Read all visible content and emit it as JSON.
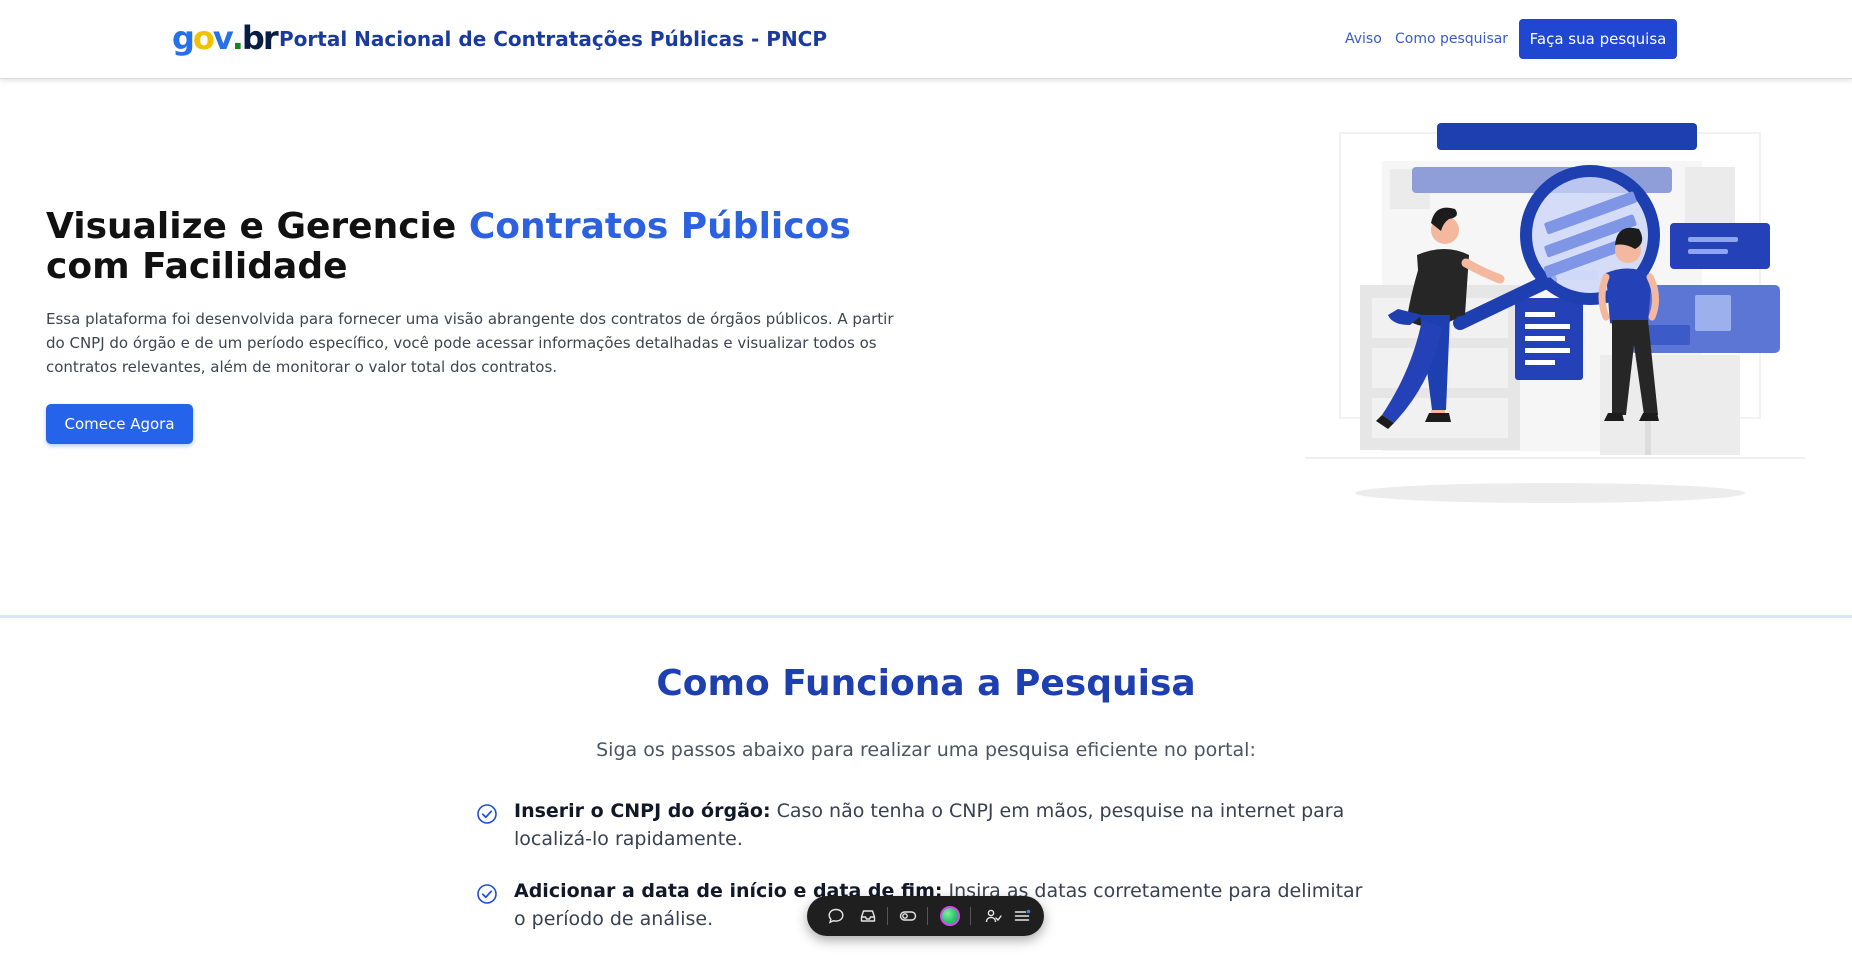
{
  "header": {
    "logo_parts": [
      "g",
      "o",
      "v",
      ".",
      "b",
      "r"
    ],
    "title": "Portal Nacional de Contratações Públicas - PNCP",
    "nav": {
      "aviso": "Aviso",
      "como_pesquisar": "Como pesquisar"
    },
    "cta": "Faça sua pesquisa"
  },
  "hero": {
    "title_part1": "Visualize e Gerencie ",
    "title_accent": "Contratos Públicos",
    "title_part2": " com Facilidade",
    "description": "Essa plataforma foi desenvolvida para fornecer uma visão abrangente dos contratos de órgãos públicos. A partir do CNPJ do órgão e de um período específico, você pode acessar informações detalhadas e visualizar todos os contratos relevantes, além de monitorar o valor total dos contratos.",
    "cta": "Comece Agora"
  },
  "how_it_works": {
    "title": "Como Funciona a Pesquisa",
    "subtitle": "Siga os passos abaixo para realizar uma pesquisa eficiente no portal:",
    "steps": [
      {
        "label": "Inserir o CNPJ do órgão:",
        "text": " Caso não tenha o CNPJ em mãos, pesquise na internet para localizá-lo rapidamente."
      },
      {
        "label": "Adicionar a data de início e data de fim:",
        "text": " Insira as datas corretamente para delimitar o período de análise."
      }
    ]
  },
  "colors": {
    "brand_blue": "#1f47d1",
    "accent_blue": "#2c62e0",
    "title_blue": "#1e3fb0",
    "gov_yellow": "#f2c100",
    "gov_green": "#168821"
  },
  "floating_toolbar": {
    "icons": [
      "comment-icon",
      "inbox-icon",
      "toggle-icon",
      "status-dot-icon",
      "users-icon",
      "menu-icon"
    ]
  }
}
